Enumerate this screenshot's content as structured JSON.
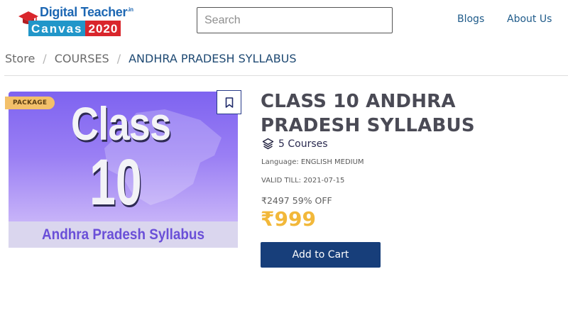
{
  "header": {
    "logo": {
      "digital": "Digital",
      "teacher": "Teacher",
      "tld": ".in",
      "canvas": "Canvas",
      "year": "2020",
      "colors": {
        "blue": "#1d67b3",
        "band_blue": "#2196c9",
        "red": "#d9262c"
      }
    },
    "search": {
      "placeholder": "Search",
      "value": ""
    },
    "nav": [
      {
        "label": "Blogs"
      },
      {
        "label": "About Us"
      }
    ]
  },
  "breadcrumb": {
    "items": [
      "Store",
      "COURSES",
      "ANDHRA PRADESH SYLLABUS"
    ],
    "separator": "/"
  },
  "course": {
    "image": {
      "line1": "Class",
      "line2": "10",
      "caption": "Andhra Pradesh Syllabus"
    },
    "badge": "PACKAGE",
    "bookmark_icon": "bookmark-icon",
    "title": "CLASS 10 ANDHRA PRADESH SYLLABUS",
    "courses_icon": "layers-icon",
    "courses_count": "5 Courses",
    "language": "Language: ENGLISH MEDIUM",
    "valid_till": "VALID TILL: 2021-07-15",
    "original_price": "₹2497 59% OFF",
    "price": "₹999",
    "cart_label": "Add to Cart",
    "colors": {
      "price": "#f2b83a",
      "button": "#173e7a",
      "badge": "#f3c06a"
    }
  }
}
